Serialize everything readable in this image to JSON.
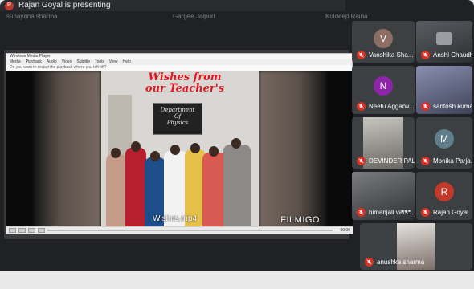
{
  "presenter": {
    "initial": "R",
    "text": "Rajan Goyal is presenting",
    "color": "#c0392b"
  },
  "ghost_labels": [
    "sunayana sharma",
    "Gargee Jaipuri",
    "Kuldeep Raina"
  ],
  "player": {
    "window_title": "Windows Media Player",
    "menu": [
      "Media",
      "Playback",
      "Audio",
      "Video",
      "Subtitle",
      "Tools",
      "View",
      "Help"
    ],
    "info": "Do you want to restart the playback where you left off?",
    "title_text": "Wishes from our Teacher's",
    "board_lines": [
      "Department",
      "Of",
      "Physics"
    ],
    "filename": "Wishes.mp4",
    "watermark": "FILMIGO",
    "progress_fraction": 0.0,
    "time": "00:00"
  },
  "participants": [
    {
      "name": "Vanshika Sha...",
      "initial": "V",
      "color": "#8d6e63",
      "type": "avatar"
    },
    {
      "name": "Anshi Chaudh...",
      "initial": "",
      "color": "#444",
      "type": "video"
    },
    {
      "name": "Neetu Aggarw...",
      "initial": "N",
      "color": "#8e24aa",
      "type": "avatar"
    },
    {
      "name": "santosh kumar",
      "initial": "",
      "color": "#444",
      "type": "video"
    },
    {
      "name": "DEVINDER PAL",
      "initial": "",
      "color": "#444",
      "type": "video"
    },
    {
      "name": "Monika Parja...",
      "initial": "M",
      "color": "#607d8b",
      "type": "avatar"
    },
    {
      "name": "himanjali vars...",
      "initial": "",
      "color": "#444",
      "type": "video"
    },
    {
      "name": "Rajan Goyal",
      "initial": "R",
      "color": "#c0392b",
      "type": "avatar"
    },
    {
      "name": "anushka sharma",
      "initial": "",
      "color": "#444",
      "type": "video"
    }
  ],
  "colors": {
    "mic_off": "#d93025",
    "tile_bg": "#3c4043",
    "title_red": "#e0141c"
  },
  "icons": {
    "mic": "mic-off-icon",
    "more": "more-dots-icon"
  }
}
